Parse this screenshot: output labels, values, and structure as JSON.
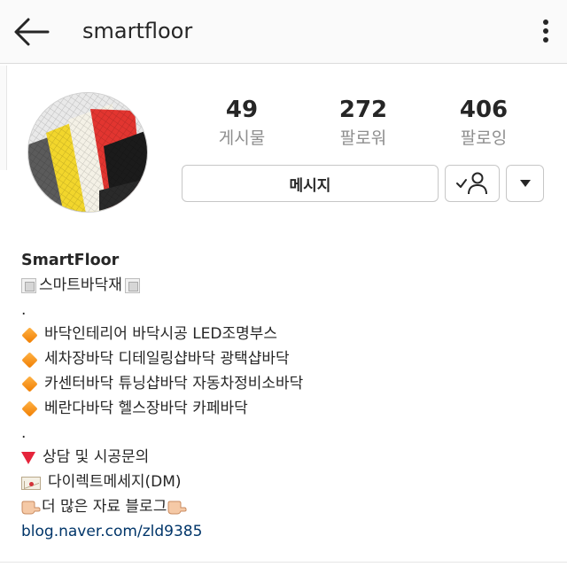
{
  "header": {
    "username": "smartfloor",
    "back_icon": "arrow-left-icon",
    "more_icon": "kebab-menu-icon"
  },
  "profile": {
    "avatar": "avatar",
    "stats": {
      "posts": {
        "count": "49",
        "label": "게시물"
      },
      "followers": {
        "count": "272",
        "label": "팔로워"
      },
      "following": {
        "count": "406",
        "label": "팔로잉"
      }
    },
    "buttons": {
      "message": "메시지",
      "follow_icon": "person-check-icon",
      "dropdown_icon": "caret-down-icon"
    }
  },
  "bio": {
    "name": "SmartFloor",
    "tagline": "스마트바닥재",
    "dot1": ".",
    "items": [
      "바닥인테리어 바닥시공 LED조명부스",
      "세차장바닥 디테일링샵바닥 광택샵바닥",
      "카센터바닥 튜닝샵바닥 자동차정비소바닥",
      "베란다바닥 헬스장바닥 카페바닥"
    ],
    "dot2": ".",
    "consult": "상담 및 시공문의",
    "dm": "다이렉트메세지(DM)",
    "blog_text": "더 많은 자료 블로그",
    "link": "blog.naver.com/zld9385"
  },
  "colors": {
    "link": "#003569",
    "muted": "#8e8e8e",
    "text": "#262626",
    "border": "#c7c7c7"
  }
}
